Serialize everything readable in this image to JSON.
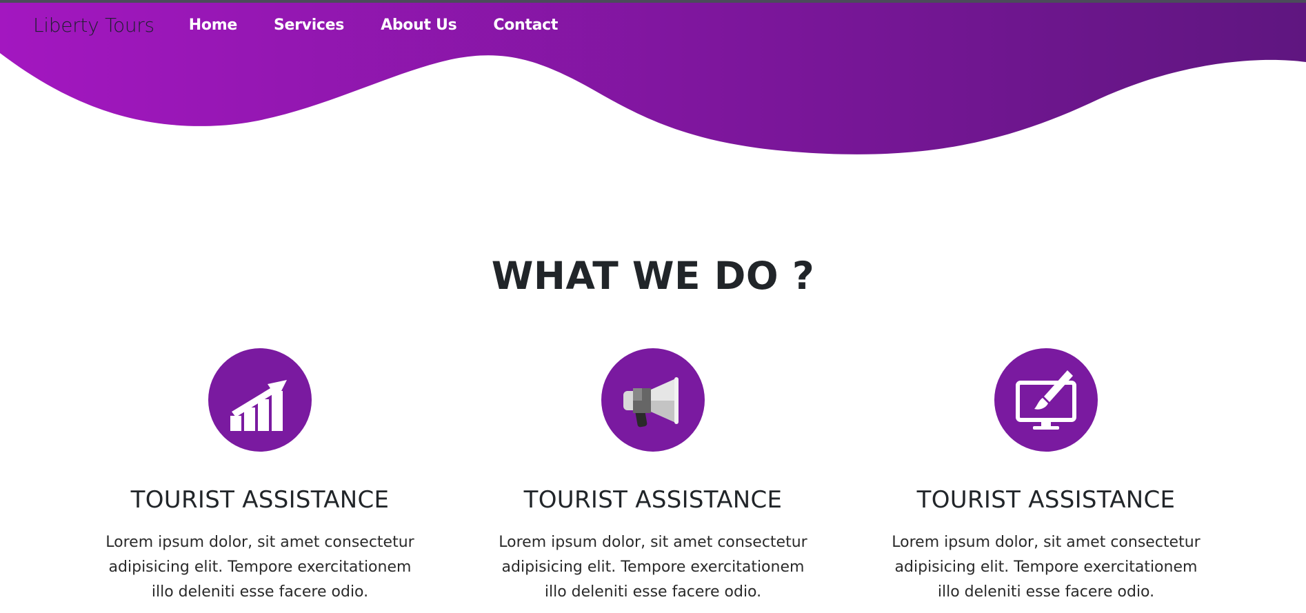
{
  "header": {
    "brand": "Liberty Tours",
    "nav": [
      {
        "label": "Home"
      },
      {
        "label": "Services"
      },
      {
        "label": "About Us"
      },
      {
        "label": "Contact"
      }
    ],
    "colors": {
      "gradient_start": "#a317c0",
      "gradient_end": "#5f1680"
    }
  },
  "main": {
    "title": "WHAT WE DO ?",
    "services": [
      {
        "icon": "growth-chart-icon",
        "title": "TOURIST ASSISTANCE",
        "text": "Lorem ipsum dolor, sit amet consectetur adipisicing elit. Tempore exercitationem illo deleniti esse facere odio."
      },
      {
        "icon": "megaphone-icon",
        "title": "TOURIST ASSISTANCE",
        "text": "Lorem ipsum dolor, sit amet consectetur adipisicing elit. Tempore exercitationem illo deleniti esse facere odio."
      },
      {
        "icon": "monitor-design-icon",
        "title": "TOURIST ASSISTANCE",
        "text": "Lorem ipsum dolor, sit amet consectetur adipisicing elit. Tempore exercitationem illo deleniti esse facere odio."
      }
    ],
    "icon_color": "#7a1aa0"
  }
}
